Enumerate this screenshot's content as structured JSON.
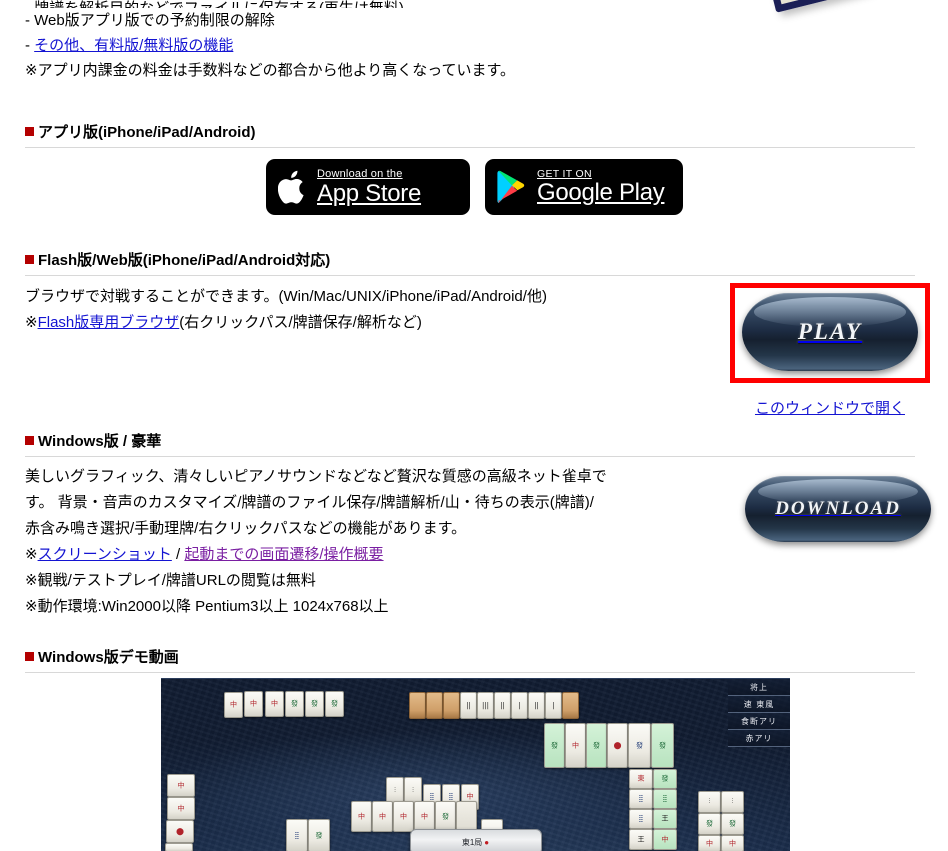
{
  "bullets": {
    "items": [
      {
        "text": "- 牌譜を解析目的などでファイルに保存する(再生は無料)",
        "link": false
      },
      {
        "text": "- Web版アプリ版での予約制限の解除",
        "link": false
      }
    ],
    "link_prefix": "-",
    "link_text": "その他、有料版/無料版の機能",
    "note": "※アプリ内課金の料金は手数料などの都合から他より高くなっています。"
  },
  "sections": {
    "app": {
      "heading": "アプリ版(iPhone/iPad/Android)",
      "appstore": {
        "small": "Download on the",
        "big": "App Store",
        "icon": "apple-icon"
      },
      "googleplay": {
        "small": "GET IT ON",
        "big": "Google Play",
        "icon": "google-play-triangle-icon"
      }
    },
    "flash": {
      "heading": "Flash版/Web版(iPhone/iPad/Android対応)",
      "line1": "ブラウザで対戦することができます。(Win/Mac/UNIX/iPhone/iPad/Android/他)",
      "line2_prefix": "※",
      "line2_link": "Flash版専用ブラウザ",
      "line2_suffix": "(右クリックパス/牌譜保存/解析など)",
      "play_label": "PLAY",
      "open_link": "このウィンドウで開く",
      "highlight_color": "#ff0000"
    },
    "windows": {
      "heading": "Windows版 / 豪華",
      "line1": "美しいグラフィック、清々しいピアノサウンドなどなど贅沢な質感の高級ネット雀卓で",
      "line2": "す。 背景・音声のカスタマイズ/牌譜のファイル保存/牌譜解析/山・待ちの表示(牌譜)/",
      "line3": "赤含み鳴き選択/手動理牌/右クリックパスなどの機能があります。",
      "line4_prefix": "※",
      "line4_link1": "スクリーンショット",
      "line4_sep": " / ",
      "line4_link2": "起動までの画面遷移/操作概要",
      "line5": "※観戦/テストプレイ/牌譜URLの閲覧は無料",
      "line6": "※動作環境:Win2000以降 Pentium3以上 1024x768以上",
      "download_label": "DOWNLOAD"
    },
    "demo": {
      "heading": "Windows版デモ動画",
      "game": {
        "status_rows": [
          "将上",
          "速 東風",
          "食断アリ",
          "赤アリ"
        ],
        "score_text": "東1局",
        "dora_text": "●"
      }
    }
  }
}
